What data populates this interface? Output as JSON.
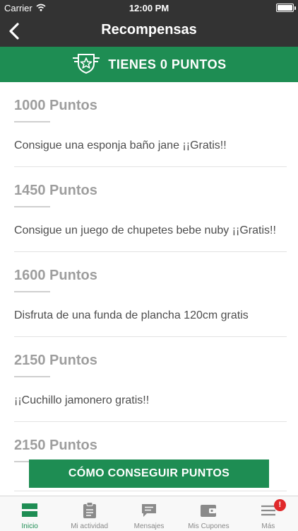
{
  "status_bar": {
    "carrier": "Carrier",
    "time": "12:00 PM"
  },
  "nav": {
    "title": "Recompensas"
  },
  "banner": {
    "text": "TIENES 0 PUNTOS"
  },
  "rewards": [
    {
      "points": "1000 Puntos",
      "description": "Consigue una esponja baño jane ¡¡Gratis!!"
    },
    {
      "points": "1450 Puntos",
      "description": "Consigue un juego de chupetes bebe nuby ¡¡Gratis!!"
    },
    {
      "points": "1600 Puntos",
      "description": "Disfruta de una funda de plancha 120cm gratis"
    },
    {
      "points": "2150 Puntos",
      "description": "¡¡Cuchillo jamonero gratis!!"
    },
    {
      "points": "2150 Puntos",
      "description": ""
    }
  ],
  "cta": {
    "label": "CÓMO CONSEGUIR PUNTOS"
  },
  "tabs": [
    {
      "label": "Inicio",
      "icon": "home-icon",
      "active": true
    },
    {
      "label": "Mi actividad",
      "icon": "clipboard-icon"
    },
    {
      "label": "Mensajes",
      "icon": "chat-icon"
    },
    {
      "label": "Mis Cupones",
      "icon": "wallet-icon"
    },
    {
      "label": "Más",
      "icon": "menu-icon",
      "badge": "!"
    }
  ],
  "colors": {
    "brand_green": "#1e8d53",
    "nav_dark": "#333333",
    "badge_red": "#e0292b"
  }
}
